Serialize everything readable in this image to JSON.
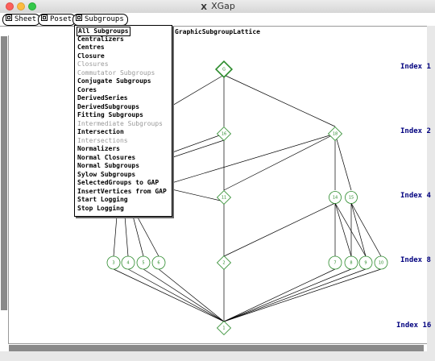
{
  "window": {
    "title": "XGap"
  },
  "toolbar": {
    "sheet": "Sheet",
    "poset": "Poset",
    "subgroups": "Subgroups"
  },
  "graph": {
    "title": "GraphicSubgroupLattice"
  },
  "levels": [
    "Index 1",
    "Index 2",
    "Index 4",
    "Index 8",
    "Index 16"
  ],
  "nodes": {
    "n0": "G",
    "n1": "1",
    "n2": "2",
    "n3": "3",
    "n4": "4",
    "n5": "5",
    "n6": "6",
    "n7": "7",
    "n8": "8",
    "n9": "9",
    "n10": "10",
    "n11": "11",
    "n14": "14",
    "n15": "15",
    "n16": "16",
    "n18": "18"
  },
  "menu": {
    "items": [
      {
        "label": "All Subgroups",
        "enabled": true
      },
      {
        "label": "Centralizers",
        "enabled": true
      },
      {
        "label": "Centres",
        "enabled": true
      },
      {
        "label": "Closure",
        "enabled": true
      },
      {
        "label": "Closures",
        "enabled": false
      },
      {
        "label": "Commutator Subgroups",
        "enabled": false
      },
      {
        "label": "Conjugate Subgroups",
        "enabled": true
      },
      {
        "label": "Cores",
        "enabled": true
      },
      {
        "label": "DerivedSeries",
        "enabled": true
      },
      {
        "label": "DerivedSubgroups",
        "enabled": true
      },
      {
        "label": "Fitting Subgroups",
        "enabled": true
      },
      {
        "label": "Intermediate Subgroups",
        "enabled": false
      },
      {
        "label": "Intersection",
        "enabled": true
      },
      {
        "label": "Intersections",
        "enabled": false
      },
      {
        "label": "Normalizers",
        "enabled": true
      },
      {
        "label": "Normal Closures",
        "enabled": true
      },
      {
        "label": "Normal Subgroups",
        "enabled": true
      },
      {
        "label": "Sylow Subgroups",
        "enabled": true
      },
      {
        "label": "SelectedGroups to GAP",
        "enabled": true
      },
      {
        "label": "InsertVertices from GAP",
        "enabled": true
      },
      {
        "label": "Start Logging",
        "enabled": true
      },
      {
        "label": "Stop Logging",
        "enabled": true
      }
    ]
  },
  "colors": {
    "node": "#2a8a2a",
    "edge": "#000000",
    "index_label": "#00007f"
  }
}
